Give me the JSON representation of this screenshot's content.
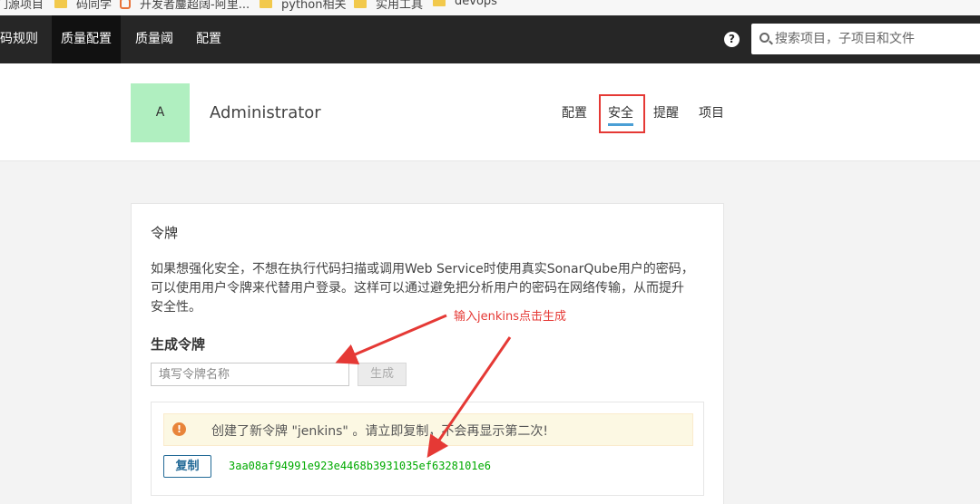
{
  "bookmarks": [
    {
      "label": "门源项目",
      "icon": "folder-icon"
    },
    {
      "label": "码同学",
      "icon": "folder-icon"
    },
    {
      "label": "开发者鏖超阔-阿里...",
      "icon": "site-icon"
    },
    {
      "label": "python相关",
      "icon": "folder-icon"
    },
    {
      "label": "实用工具",
      "icon": "folder-icon"
    },
    {
      "label": "devops",
      "icon": "folder-icon"
    }
  ],
  "nav": {
    "items": [
      "码规则",
      "质量配置",
      "质量阈",
      "配置"
    ],
    "active_index": 1,
    "help_glyph": "?",
    "search_placeholder": "搜索项目，子项目和文件"
  },
  "profile": {
    "avatar_letter": "A",
    "avatar_color": "#b0efc0",
    "name": "Administrator",
    "tabs": [
      "配置",
      "安全",
      "提醒",
      "项目"
    ],
    "active_tab": "安全"
  },
  "tokens": {
    "title": "令牌",
    "description": "如果想强化安全，不想在执行代码扫描或调用Web Service时使用真实SonarQube用户的密码，可以使用用户令牌来代替用户登录。这样可以通过避免把分析用户的密码在网络传输，从而提升安全性。",
    "generate_title": "生成令牌",
    "input_placeholder": "填写令牌名称",
    "generate_button": "生成",
    "warning_glyph": "!",
    "warning": "创建了新令牌 \"jenkins\" 。请立即复制，不会再显示第二次!",
    "copy_button": "复制",
    "token_value": "3aa08af94991e923e4468b3931035ef6328101e6"
  },
  "annotation": {
    "text": "输入jenkins点击生成",
    "color": "#e53935"
  }
}
